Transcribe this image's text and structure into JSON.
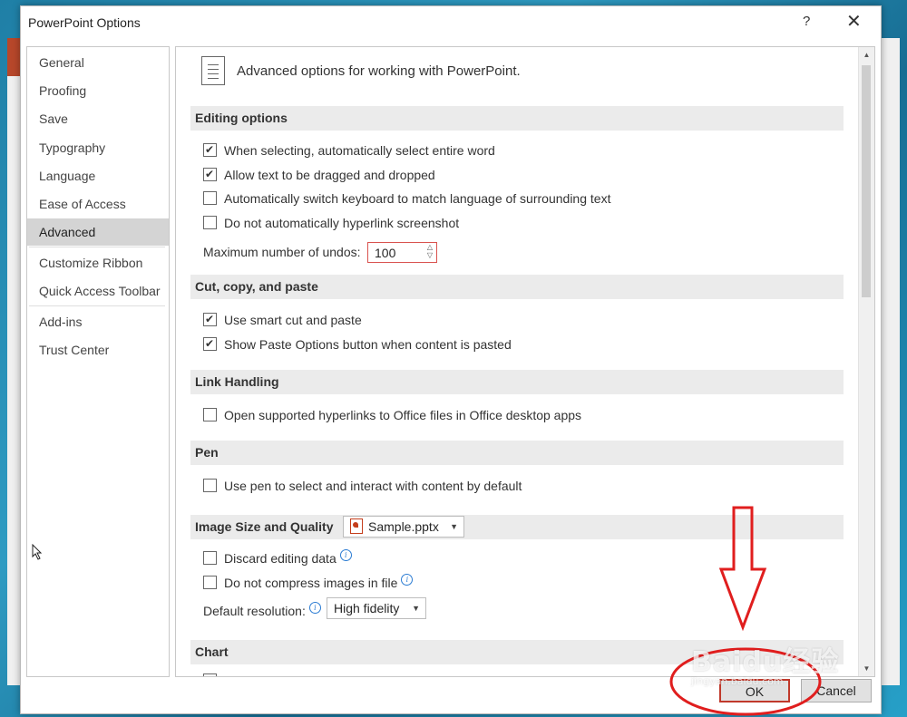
{
  "dialog": {
    "title": "PowerPoint Options",
    "help_label": "?",
    "close_label": "✕"
  },
  "sidebar": {
    "items": [
      {
        "label": "General"
      },
      {
        "label": "Proofing"
      },
      {
        "label": "Save"
      },
      {
        "label": "Typography"
      },
      {
        "label": "Language"
      },
      {
        "label": "Ease of Access"
      },
      {
        "label": "Advanced",
        "selected": true
      },
      {
        "label": "Customize Ribbon"
      },
      {
        "label": "Quick Access Toolbar"
      },
      {
        "label": "Add-ins"
      },
      {
        "label": "Trust Center"
      }
    ]
  },
  "content": {
    "header": "Advanced options for working with PowerPoint.",
    "sections": {
      "editing": "Editing options",
      "cut_copy_paste": "Cut, copy, and paste",
      "link_handling": "Link Handling",
      "pen": "Pen",
      "image_size": "Image Size and Quality",
      "chart": "Chart"
    },
    "editing_options": [
      {
        "label": "When selecting, automatically select entire word",
        "checked": true
      },
      {
        "label": "Allow text to be dragged and dropped",
        "checked": true
      },
      {
        "label": "Automatically switch keyboard to match language of surrounding text",
        "checked": false
      },
      {
        "label": "Do not automatically hyperlink screenshot",
        "checked": false
      }
    ],
    "undos": {
      "label": "Maximum number of undos:",
      "value": "100"
    },
    "cut_copy_paste_options": [
      {
        "label": "Use smart cut and paste",
        "checked": true
      },
      {
        "label": "Show Paste Options button when content is pasted",
        "checked": true
      }
    ],
    "link_handling_options": [
      {
        "label": "Open supported hyperlinks to Office files in Office desktop apps",
        "checked": false
      }
    ],
    "pen_options": [
      {
        "label": "Use pen to select and interact with content by default",
        "checked": false
      }
    ],
    "image_size": {
      "file_select": "Sample.pptx",
      "options": [
        {
          "label": "Discard editing data",
          "checked": false
        },
        {
          "label": "Do not compress images in file",
          "checked": false
        }
      ],
      "resolution_label": "Default resolution:",
      "resolution_value": "High fidelity"
    }
  },
  "buttons": {
    "ok": "OK",
    "cancel": "Cancel"
  },
  "watermark": {
    "text": "Baidu经验",
    "sub": "jingyan.baidu.com"
  },
  "colors": {
    "annotation": "#e01e1e",
    "selected_nav": "#d4d4d4",
    "section_bg": "#ebebeb"
  }
}
